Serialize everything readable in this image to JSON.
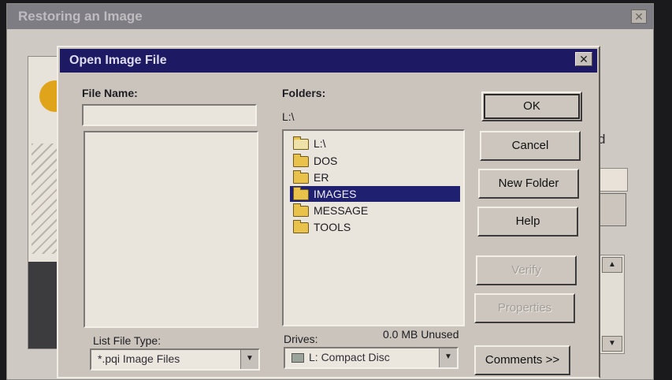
{
  "background_window": {
    "title": "Restoring an Image",
    "partial_letter": "d"
  },
  "dialog": {
    "title": "Open Image File",
    "file_name_label": "File Name:",
    "file_name_value": "",
    "folders_label": "Folders:",
    "current_path": "L:\\",
    "folders": [
      {
        "label": "L:\\",
        "selected": false,
        "root": true
      },
      {
        "label": "DOS",
        "selected": false,
        "root": false
      },
      {
        "label": "ER",
        "selected": false,
        "root": false
      },
      {
        "label": "IMAGES",
        "selected": true,
        "root": false
      },
      {
        "label": "MESSAGE",
        "selected": false,
        "root": false
      },
      {
        "label": "TOOLS",
        "selected": false,
        "root": false
      }
    ],
    "list_file_type_label": "List File Type:",
    "list_file_type_value": "*.pqi  Image Files",
    "drives_label": "Drives:",
    "drive_value": "L:  Compact Disc",
    "unused_text": "0.0 MB Unused",
    "buttons": {
      "ok": "OK",
      "cancel": "Cancel",
      "new_folder": "New Folder",
      "help": "Help",
      "verify": "Verify",
      "properties": "Properties",
      "comments": "Comments >>"
    }
  },
  "colors": {
    "title_active": "#1d1a63",
    "selection": "#202070",
    "dialog_face": "#cac4bd"
  }
}
